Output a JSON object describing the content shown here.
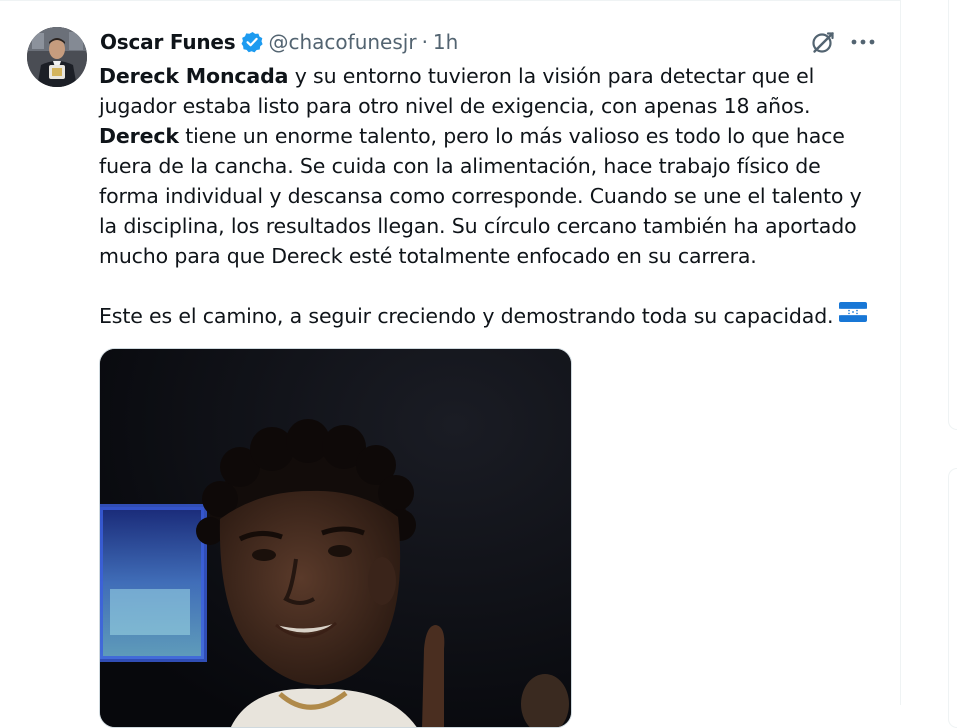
{
  "tweet": {
    "author": {
      "display_name": "Oscar Funes",
      "handle": "@chacofunesjr",
      "verified": true
    },
    "separator": "·",
    "time": "1h",
    "text_lines": [
      {
        "bold": "Dereck Moncada",
        "rest": " y su entorno tuvieron la visión para detectar que el"
      },
      {
        "bold": "",
        "rest": "jugador estaba listo para otro nivel de exigencia, con apenas 18 años."
      },
      {
        "bold": "Dereck",
        "rest": " tiene un enorme talento, pero lo más valioso es todo lo que hace"
      },
      {
        "bold": "",
        "rest": "fuera de la cancha. Se cuida con la alimentación, hace trabajo físico de"
      },
      {
        "bold": "",
        "rest": "forma individual y descansa como corresponde. Cuando se une el talento y"
      },
      {
        "bold": "",
        "rest": "la disciplina, los resultados llegan. Su círculo cercano también ha aportado"
      },
      {
        "bold": "",
        "rest": "mucho para que Dereck esté totalmente enfocado en su carrera."
      }
    ],
    "closing_line": "Este es el camino, a seguir creciendo y demostrando toda su capacidad.",
    "flag": "honduras-flag-emoji"
  },
  "icons": {
    "verified": "verified-badge-icon",
    "grok": "grok-icon",
    "more": "more-options-icon"
  },
  "colors": {
    "verified_blue": "#1d9bf0",
    "secondary_text": "#536471",
    "primary_text": "#0f1419",
    "border": "#eff3f4",
    "honduras_blue": "#1877d6"
  }
}
